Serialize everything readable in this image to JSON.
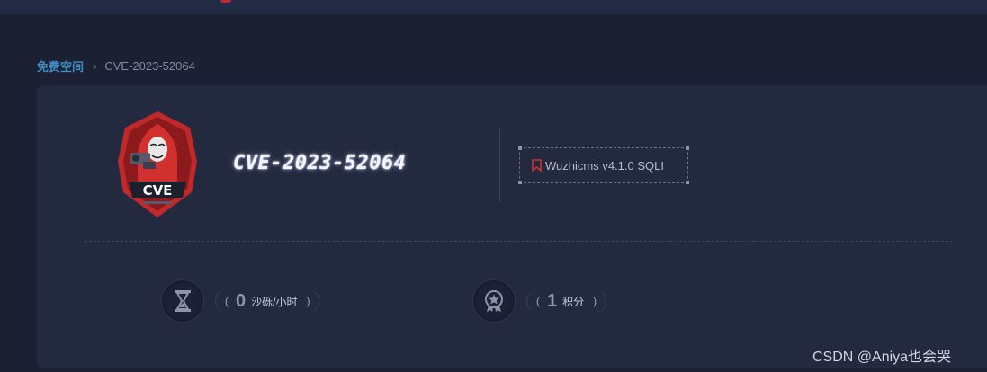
{
  "breadcrumb": {
    "home": "免费空间",
    "separator": "›",
    "current": "CVE-2023-52064"
  },
  "challenge": {
    "title": "CVE-2023-52064",
    "logo_text": "CVE",
    "tag": "Wuzhicms v4.1.0 SQLI"
  },
  "stats": {
    "sand": {
      "open": "(",
      "value": "0",
      "unit": "沙砾/小时",
      "close": ")",
      "icon": "hourglass-icon"
    },
    "points": {
      "open": "(",
      "value": "1",
      "unit": "积分",
      "close": ")",
      "icon": "medal-icon"
    }
  },
  "watermark": "CSDN @Aniya也会哭",
  "colors": {
    "background": "#1b2033",
    "card": "#232a40",
    "link": "#3f8fc7",
    "accent_red": "#c0282a"
  }
}
